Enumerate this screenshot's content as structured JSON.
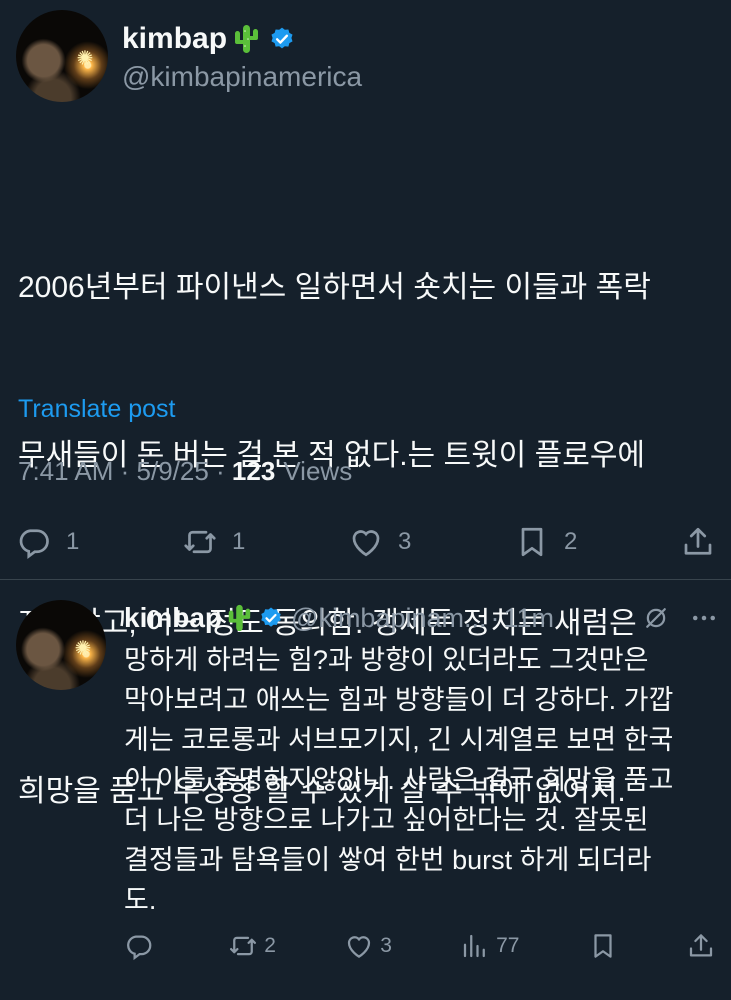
{
  "main_tweet": {
    "display_name": "kimbap",
    "handle": "@kimbapinamerica",
    "text": "2006년부터 파이낸스 일하면서 숏치는 이들과 폭락무새들이 돈 버는 걸 본 적 없다.는 트윗이 플로우에 지나갔고, 어느 정도 동의함. 갱제든 정치든 새럼은 희망을 품고 우상향 할 수 있게 살 수 밖에 없어서.",
    "text_lines": [
      "2006년부터 파이낸스 일하면서 숏치는 이들과 폭락",
      "무새들이 돈 버는 걸 본 적 없다.는 트윗이 플로우에",
      "지나갔고, 어느 정도 동의함. 갱제든 정치든 새럼은",
      "희망을 품고 우상향 할 수 있게 살 수 밖에 없어서."
    ],
    "translate_label": "Translate post",
    "time": "7:41 AM",
    "date": "5/9/25",
    "views_count": "123",
    "views_label": "Views",
    "separator": " · ",
    "actions": {
      "replies": "1",
      "reposts": "1",
      "likes": "3",
      "bookmarks": "2"
    }
  },
  "reply_tweet": {
    "display_name": "kimbap",
    "handle": "@kimbapinam...",
    "dot": "·",
    "time": "11m",
    "text_lines": [
      "망하게 하려는 힘?과 방향이 있더라도 그것만은",
      "막아보려고 애쓰는 힘과 방향들이 더 강하다. 가깝",
      "게는 코로롱과 서브모기지, 긴 시계열로 보면 한국",
      "이 이를 증명하지않았나. 사람은 결국 희망을 품고",
      "더 나은 방향으로 나가고 싶어한다는 것. 잘못된",
      "결정들과 탐욕들이 쌓여 한번 burst 하게 되더라",
      "도."
    ],
    "actions": {
      "replies": "",
      "reposts": "2",
      "likes": "3",
      "views": "77"
    }
  },
  "icons": {
    "verified": "verified-badge-icon",
    "cactus": "cactus-emoji-icon",
    "reply": "reply-icon",
    "repost": "repost-icon",
    "like": "heart-icon",
    "bookmark": "bookmark-icon",
    "share": "share-icon",
    "views": "views-icon",
    "grok": "grok-icon",
    "more": "more-icon"
  },
  "colors": {
    "background": "#15202b",
    "text": "#f7f9f9",
    "secondary": "#8b98a5",
    "accent": "#1d9bf0",
    "divider": "#38444d"
  }
}
